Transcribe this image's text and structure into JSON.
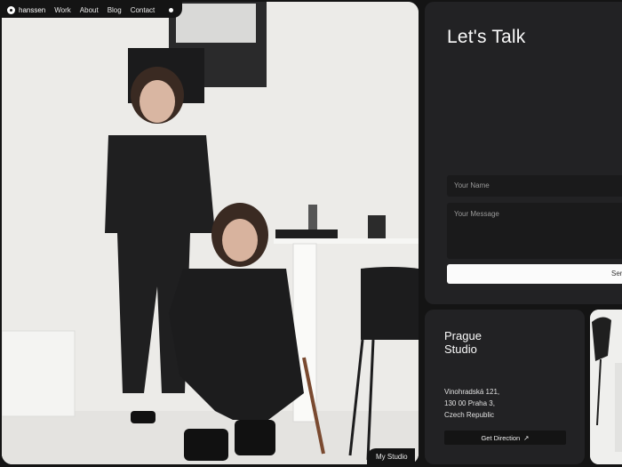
{
  "nav": {
    "brand": "hanssen",
    "links": [
      "Work",
      "About",
      "Blog",
      "Contact"
    ]
  },
  "hero": {
    "image_alt": "photo-two-women-in-studio",
    "tag": "My Studio"
  },
  "contact": {
    "title": "Let's Talk",
    "name_placeholder": "Your Name",
    "message_placeholder": "Your Message",
    "send_label": "Sen"
  },
  "studio": {
    "title": "Prague Studio",
    "address": [
      "Vinohradská 121,",
      "130 00 Praha 3,",
      "Czech Republic"
    ],
    "direction_label": "Get Direction",
    "direction_icon": "arrow-up-right-icon"
  },
  "colors": {
    "page_bg": "#141414",
    "panel_bg": "#222224",
    "accent": "#ffffff"
  }
}
